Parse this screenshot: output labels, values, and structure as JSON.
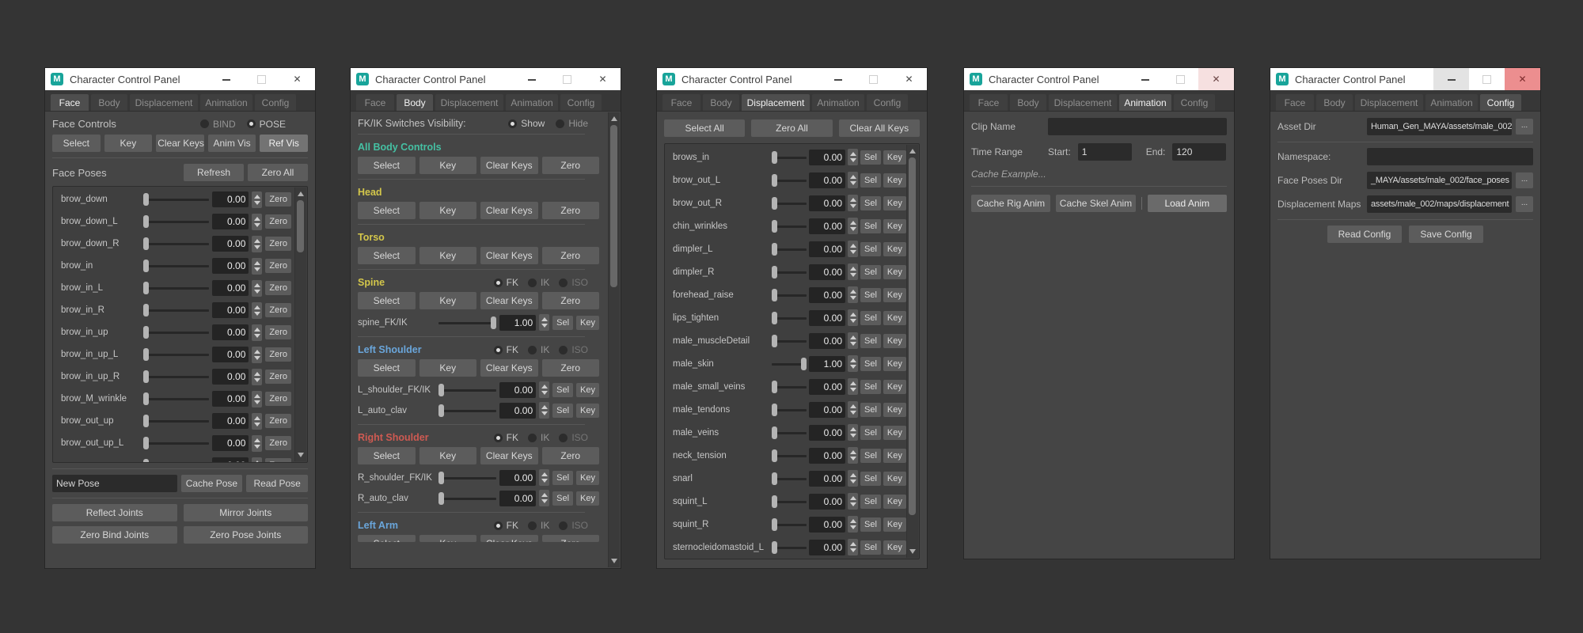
{
  "app": {
    "title": "Character Control Panel",
    "tabs": [
      "Face",
      "Body",
      "Displacement",
      "Animation",
      "Config"
    ]
  },
  "icons": {
    "maya_logo": "M",
    "close": "✕"
  },
  "colors": {
    "teal_section": "#45c0a3",
    "yellow_section": "#d3c64b",
    "blue_section": "#6aa6db",
    "red_section": "#ce5a52",
    "close_highlight": "#ec8e8f"
  },
  "windows": [
    {
      "active_tab": "Face"
    },
    {
      "active_tab": "Body"
    },
    {
      "active_tab": "Displacement"
    },
    {
      "active_tab": "Animation"
    },
    {
      "active_tab": "Config"
    }
  ],
  "face": {
    "controls_label": "Face Controls",
    "bind_label": "BIND",
    "pose_label": "POSE",
    "selected_mode": "POSE",
    "buttons": [
      "Select",
      "Key",
      "Clear Keys",
      "Anim Vis",
      "Ref Vis"
    ],
    "highlighted_button": "Ref Vis",
    "poses_label": "Face Poses",
    "refresh": "Refresh",
    "zero_all": "Zero All",
    "default_value": "0.00",
    "zero": "Zero",
    "sliders": [
      "brow_down",
      "brow_down_L",
      "brow_down_R",
      "brow_in",
      "brow_in_L",
      "brow_in_R",
      "brow_in_up",
      "brow_in_up_L",
      "brow_in_up_R",
      "brow_M_wrinkle",
      "brow_out_up",
      "brow_out_up_L"
    ],
    "pose_field": "New Pose",
    "cache_pose": "Cache Pose",
    "read_pose": "Read Pose",
    "reflect": "Reflect Joints",
    "mirror": "Mirror Joints",
    "zero_bind": "Zero Bind Joints",
    "zero_pose": "Zero Pose Joints"
  },
  "body": {
    "visibility_label": "FK/IK Switches Visibility:",
    "show": "Show",
    "hide": "Hide",
    "visibility_selected": "Show",
    "section_buttons": [
      "Select",
      "Key",
      "Clear Keys",
      "Zero"
    ],
    "fkik_options": [
      "FK",
      "IK",
      "ISO"
    ],
    "fkik_selected": "FK",
    "sel": "Sel",
    "key": "Key",
    "sections": [
      {
        "name": "All Body Controls",
        "color": "#45c0a3",
        "radios": false,
        "sliders": []
      },
      {
        "name": "Head",
        "color": "#d3c64b",
        "radios": false,
        "sliders": []
      },
      {
        "name": "Torso",
        "color": "#d3c64b",
        "radios": false,
        "sliders": []
      },
      {
        "name": "Spine",
        "color": "#d3c64b",
        "radios": true,
        "sliders": [
          {
            "name": "spine_FK/IK",
            "value": "1.00",
            "handle": "right"
          }
        ]
      },
      {
        "name": "Left Shoulder",
        "color": "#6aa6db",
        "radios": true,
        "sliders": [
          {
            "name": "L_shoulder_FK/IK",
            "value": "0.00",
            "handle": "left"
          },
          {
            "name": "L_auto_clav",
            "value": "0.00",
            "handle": "left"
          }
        ]
      },
      {
        "name": "Right Shoulder",
        "color": "#ce5a52",
        "radios": true,
        "sliders": [
          {
            "name": "R_shoulder_FK/IK",
            "value": "0.00",
            "handle": "left"
          },
          {
            "name": "R_auto_clav",
            "value": "0.00",
            "handle": "left"
          }
        ]
      },
      {
        "name": "Left Arm",
        "color": "#6aa6db",
        "radios": true,
        "sliders": [],
        "clipped": true
      }
    ]
  },
  "displacement": {
    "top_buttons": [
      "Select All",
      "Zero All",
      "Clear All Keys"
    ],
    "sel": "Sel",
    "key": "Key",
    "rows": [
      {
        "name": "brows_in",
        "value": "0.00",
        "handle": "left"
      },
      {
        "name": "brow_out_L",
        "value": "0.00",
        "handle": "left"
      },
      {
        "name": "brow_out_R",
        "value": "0.00",
        "handle": "left"
      },
      {
        "name": "chin_wrinkles",
        "value": "0.00",
        "handle": "left"
      },
      {
        "name": "dimpler_L",
        "value": "0.00",
        "handle": "left"
      },
      {
        "name": "dimpler_R",
        "value": "0.00",
        "handle": "left"
      },
      {
        "name": "forehead_raise",
        "value": "0.00",
        "handle": "left"
      },
      {
        "name": "lips_tighten",
        "value": "0.00",
        "handle": "left"
      },
      {
        "name": "male_muscleDetail",
        "value": "0.00",
        "handle": "left"
      },
      {
        "name": "male_skin",
        "value": "1.00",
        "handle": "right"
      },
      {
        "name": "male_small_veins",
        "value": "0.00",
        "handle": "left"
      },
      {
        "name": "male_tendons",
        "value": "0.00",
        "handle": "left"
      },
      {
        "name": "male_veins",
        "value": "0.00",
        "handle": "left"
      },
      {
        "name": "neck_tension",
        "value": "0.00",
        "handle": "left"
      },
      {
        "name": "snarl",
        "value": "0.00",
        "handle": "left"
      },
      {
        "name": "squint_L",
        "value": "0.00",
        "handle": "left"
      },
      {
        "name": "squint_R",
        "value": "0.00",
        "handle": "left"
      },
      {
        "name": "sternocleidomastoid_L",
        "value": "0.00",
        "handle": "left"
      }
    ]
  },
  "animation": {
    "clip_name_label": "Clip Name",
    "clip_name_value": "",
    "time_range_label": "Time Range",
    "start_label": "Start:",
    "start_value": "1",
    "end_label": "End:",
    "end_value": "120",
    "note": "Cache Example...",
    "cache_rig": "Cache Rig Anim",
    "cache_skel": "Cache Skel Anim",
    "load_anim": "Load Anim"
  },
  "config": {
    "rows": [
      {
        "label": "Asset Dir",
        "value": "Human_Gen_MAYA/assets/male_002",
        "browse": true
      },
      {
        "label": "Namespace:",
        "value": "",
        "browse": false
      },
      {
        "label": "Face Poses Dir",
        "value": "_MAYA/assets/male_002/face_poses",
        "browse": true
      },
      {
        "label": "Displacement Maps",
        "value": "assets/male_002/maps/displacement",
        "browse": true
      }
    ],
    "browse_label": "...",
    "read_config": "Read Config",
    "save_config": "Save Config"
  }
}
